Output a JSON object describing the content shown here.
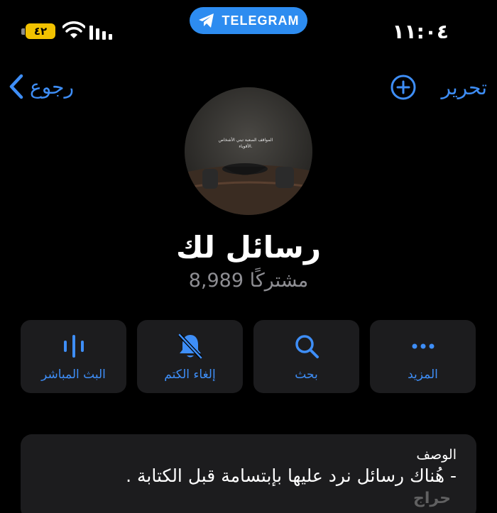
{
  "status_bar": {
    "battery_level": "٤٢",
    "time": "١١:٠٤",
    "app_pill": "TELEGRAM",
    "battery_color": "#f2c200"
  },
  "nav": {
    "back_label": "رجوع",
    "edit_label": "تحرير"
  },
  "channel": {
    "name": "رسائل لك",
    "subscribers": "8,989 مشتركًا",
    "avatar_caption": "المواقف الصعبة تبني الأشخاص الأقوياء."
  },
  "actions": [
    {
      "label": "البث المباشر",
      "icon": "live-stream-icon"
    },
    {
      "label": "إلغاء الكتم",
      "icon": "bell-slash-icon"
    },
    {
      "label": "بحث",
      "icon": "search-icon"
    },
    {
      "label": "المزيد",
      "icon": "more-icon"
    }
  ],
  "description": {
    "title": "الوصف",
    "text": "- هُناك رسائل نرد عليها بإبتسامة قبل الكتابة ."
  },
  "watermark": "حراج",
  "colors": {
    "accent": "#3e8ef7",
    "background": "#000000",
    "card": "#1c1c1e",
    "telegram_pill": "#2d8cf0",
    "secondary_text": "#8e8e93"
  }
}
